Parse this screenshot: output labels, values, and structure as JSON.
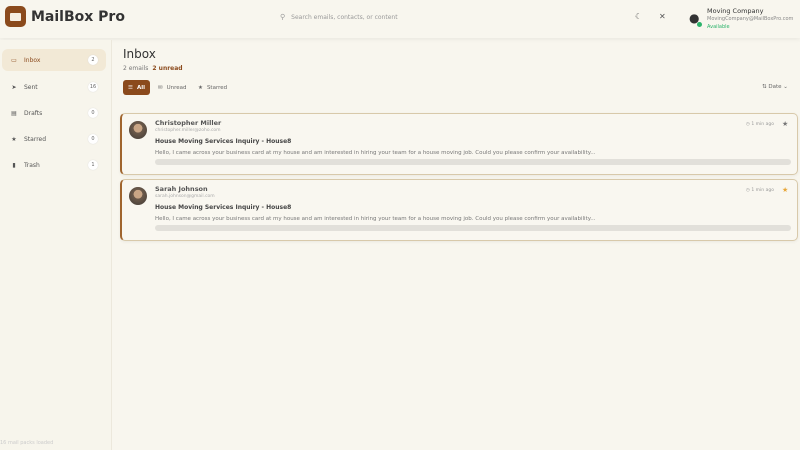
{
  "app": {
    "name": "MailBox Pro",
    "accent": "#8b4a1c"
  },
  "search": {
    "placeholder": "Search emails, contacts, or content"
  },
  "header": {
    "theme_icon": "moon-icon",
    "close_icon": "close-icon"
  },
  "user": {
    "name": "Moving Company",
    "email": "MovingCompany@MailBoxPro.com",
    "status": "Available",
    "status_color": "#2cb36b"
  },
  "sidebar": {
    "items": [
      {
        "label": "Inbox",
        "count": "2",
        "icon": "inbox-icon",
        "active": true
      },
      {
        "label": "Sent",
        "count": "16",
        "icon": "send-icon"
      },
      {
        "label": "Drafts",
        "count": "0",
        "icon": "draft-icon"
      },
      {
        "label": "Starred",
        "count": "0",
        "icon": "star-icon"
      },
      {
        "label": "Trash",
        "count": "1",
        "icon": "trash-icon"
      }
    ],
    "footer": "16 mail packs loaded"
  },
  "main": {
    "title": "Inbox",
    "count_text": "2 emails",
    "unread_text": "2 unread",
    "filters": [
      {
        "label": "All",
        "active": true
      },
      {
        "label": "Unread"
      },
      {
        "label": "Starred"
      }
    ],
    "sort_label": "Date",
    "emails": [
      {
        "from": "Christopher Miller",
        "address": "christopher.miller@zoho.com",
        "subject": "House Moving Services Inquiry - House8",
        "preview": "Hello, I came across your business card at my house and am interested in hiring your team for a house moving job. Could you please confirm your availability...",
        "time": "1 min ago",
        "starred": false
      },
      {
        "from": "Sarah Johnson",
        "address": "sarah.johnson@gmail.com",
        "subject": "House Moving Services Inquiry - House8",
        "preview": "Hello, I came across your business card at my house and am interested in hiring your team for a house moving job. Could you please confirm your availability...",
        "time": "1 min ago",
        "starred": true
      }
    ]
  }
}
